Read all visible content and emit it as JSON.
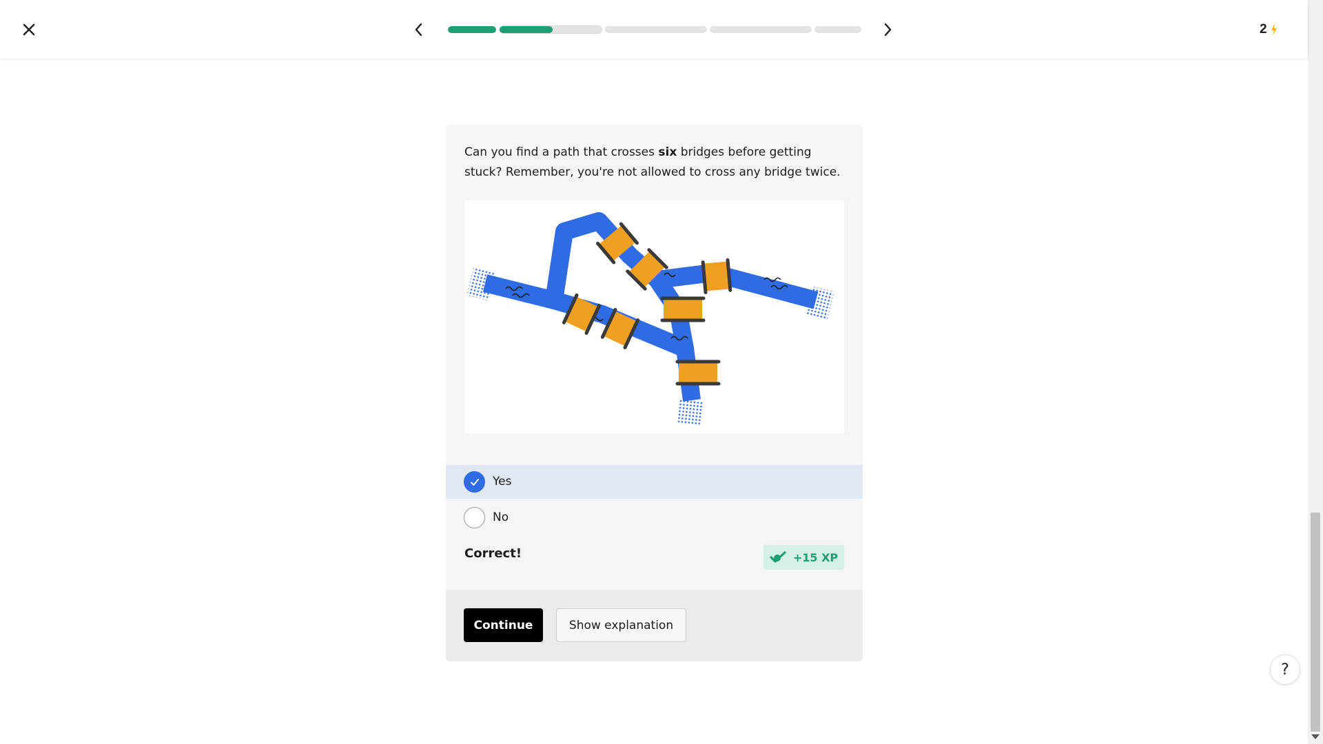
{
  "header": {
    "streak_count": "2",
    "icons": {
      "close": "close-icon",
      "prev": "chevron-left-icon",
      "next": "chevron-right-icon",
      "streak": "lightning-icon"
    },
    "progress_segments": [
      {
        "fill": 1.0
      },
      {
        "fill": 0.52,
        "current": true
      },
      {
        "fill": 0.0
      },
      {
        "fill": 0.0
      },
      {
        "fill": 0.0
      }
    ]
  },
  "question": {
    "prompt_part1": "Can you find a path that crosses ",
    "prompt_bold": "six",
    "prompt_part2": " bridges before getting stuck? Remember, you're not allowed to cross any bridge twice."
  },
  "figure": {
    "bridge_count": 7,
    "colors": {
      "water": "#2f6be3",
      "bridge": "#f0a020",
      "rail": "#3a3a3a"
    }
  },
  "options": [
    {
      "label": "Yes",
      "selected": true
    },
    {
      "label": "No",
      "selected": false
    }
  ],
  "feedback": {
    "result": "Correct!",
    "xp": "+15 XP"
  },
  "actions": {
    "continue_label": "Continue",
    "explain_label": "Show explanation"
  },
  "help": {
    "label": "?"
  },
  "colors": {
    "accent_green": "#1d9e74",
    "selected_bg": "#e1e8f3",
    "radio_checked": "#2f6be3",
    "xp_bg": "#d3efe6",
    "streak": "#f5b300"
  }
}
